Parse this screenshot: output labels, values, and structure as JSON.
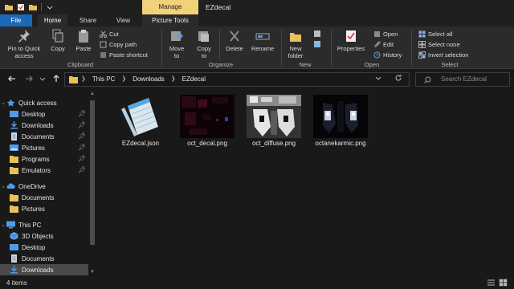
{
  "titlebar": {
    "context_tab": "Manage",
    "window_title": "EZdecal"
  },
  "ribbon_tabs": {
    "file": "File",
    "home": "Home",
    "share": "Share",
    "view": "View",
    "picture_tools": "Picture Tools"
  },
  "ribbon": {
    "clipboard": {
      "pin_line1": "Pin to Quick",
      "pin_line2": "access",
      "copy": "Copy",
      "paste": "Paste",
      "cut": "Cut",
      "copy_path": "Copy path",
      "paste_shortcut": "Paste shortcut",
      "label": "Clipboard"
    },
    "organize": {
      "move_line1": "Move",
      "move_line2": "to",
      "copy_line1": "Copy",
      "copy_line2": "to",
      "delete": "Delete",
      "rename": "Rename",
      "label": "Organize"
    },
    "new": {
      "new_folder_line1": "New",
      "new_folder_line2": "folder",
      "label": "New"
    },
    "open": {
      "properties": "Properties",
      "open": "Open",
      "edit": "Edit",
      "history": "History",
      "label": "Open"
    },
    "select": {
      "select_all": "Select all",
      "select_none": "Select none",
      "invert_selection": "Invert selection",
      "label": "Select"
    }
  },
  "address": {
    "crumbs": [
      "This PC",
      "Downloads",
      "EZdecal"
    ],
    "search_placeholder": "Search EZdecal"
  },
  "nav": {
    "items": [
      {
        "label": "Quick access",
        "icon": "star-icon",
        "pinned": false
      },
      {
        "label": "Desktop",
        "icon": "desktop-folder-icon",
        "pinned": true
      },
      {
        "label": "Downloads",
        "icon": "downloads-folder-icon",
        "pinned": true
      },
      {
        "label": "Documents",
        "icon": "documents-folder-icon",
        "pinned": true
      },
      {
        "label": "Pictures",
        "icon": "pictures-folder-icon",
        "pinned": true
      },
      {
        "label": "Programs",
        "icon": "folder-icon",
        "pinned": true
      },
      {
        "label": "Emulators",
        "icon": "folder-icon",
        "pinned": true
      },
      {
        "label": "OneDrive",
        "icon": "cloud-icon",
        "pinned": false
      },
      {
        "label": "Documents",
        "icon": "folder-icon",
        "pinned": false
      },
      {
        "label": "Pictures",
        "icon": "folder-icon",
        "pinned": false
      },
      {
        "label": "This PC",
        "icon": "computer-icon",
        "pinned": false
      },
      {
        "label": "3D Objects",
        "icon": "3d-objects-icon",
        "pinned": false
      },
      {
        "label": "Desktop",
        "icon": "desktop-folder-icon",
        "pinned": false
      },
      {
        "label": "Documents",
        "icon": "documents-folder-icon",
        "pinned": false
      },
      {
        "label": "Downloads",
        "icon": "downloads-folder-icon",
        "pinned": false
      }
    ]
  },
  "files": [
    {
      "name": "EZdecal.json",
      "icon": "notepad-icon"
    },
    {
      "name": "oct_decal.png",
      "icon": "image-thumbnail"
    },
    {
      "name": "oct_diffuse.png",
      "icon": "image-thumbnail"
    },
    {
      "name": "octanekarmic.png",
      "icon": "image-thumbnail"
    }
  ],
  "status": {
    "count": "4 items"
  },
  "colors": {
    "accent": "#1a68b8",
    "manage_tab": "#f1d27a",
    "background": "#191919",
    "ribbon": "#2b2b2b"
  }
}
